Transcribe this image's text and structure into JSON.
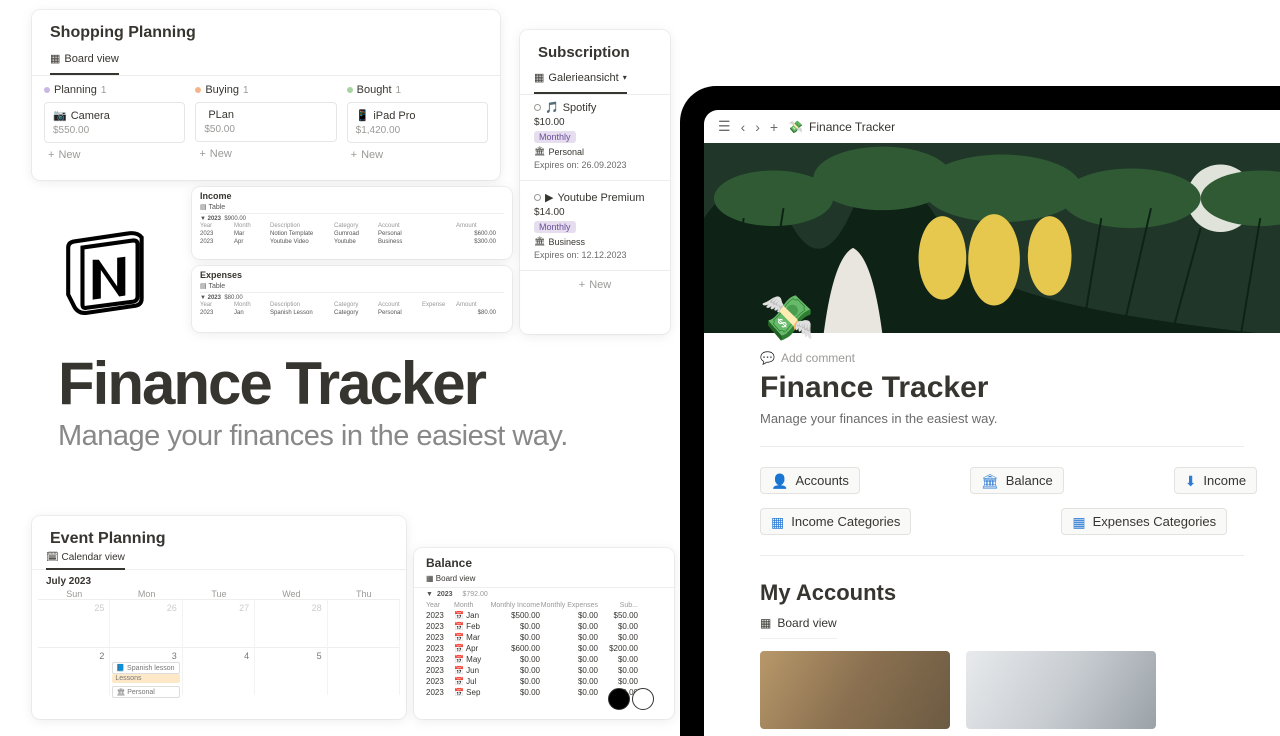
{
  "shopping": {
    "title": "Shopping Planning",
    "view": "Board view",
    "cols": [
      {
        "name": "Planning",
        "count": "1",
        "dot": "#c9b8e4",
        "card_icon": "📷",
        "card_title": "Camera",
        "card_price": "$550.00"
      },
      {
        "name": "Buying",
        "count": "1",
        "dot": "#f5b58b",
        "card_icon": "",
        "card_title": "PLan",
        "card_price": "$50.00"
      },
      {
        "name": "Bought",
        "count": "1",
        "dot": "#a8d4a2",
        "card_icon": "📱",
        "card_title": "iPad Pro",
        "card_price": "$1,420.00"
      }
    ],
    "new_label": "New"
  },
  "subs": {
    "title": "Subscription",
    "view": "Galerieansicht",
    "items": [
      {
        "icon": "🎵",
        "name": "Spotify",
        "price": "$10.00",
        "period": "Monthly",
        "period_bg": "#e6deee",
        "period_fg": "#6a4f9a",
        "acct_icon": "🏛",
        "acct": "Personal",
        "expires": "Expires on: 26.09.2023"
      },
      {
        "icon": "▶",
        "name": "Youtube Premium",
        "price": "$14.00",
        "period": "Monthly",
        "period_bg": "#e6deee",
        "period_fg": "#6a4f9a",
        "acct_icon": "🏛",
        "acct": "Business",
        "expires": "Expires on: 12.12.2023"
      }
    ],
    "new_label": "New"
  },
  "income_thumb": {
    "title": "Income",
    "tab": "Table",
    "year_head": "2023",
    "year_val": "$900.00",
    "rows": [
      {
        "y": "2023",
        "m": "Mar",
        "d": "Notion Template",
        "a": "Gumroad",
        "acc": "Personal",
        "amt": "$600.00"
      },
      {
        "y": "2023",
        "m": "Apr",
        "d": "Youtube Video",
        "a": "Youtube",
        "acc": "Business",
        "amt": "$300.00"
      }
    ],
    "cols": [
      "Year",
      "Month",
      "Description",
      "Category",
      "Account",
      "",
      "Amount"
    ]
  },
  "expenses_thumb": {
    "title": "Expenses",
    "tab": "Table",
    "year_head": "2023",
    "year_val": "$80.00",
    "rows": [
      {
        "y": "2023",
        "m": "Jan",
        "d": "Spanish Lesson",
        "a": "Category",
        "acc": "Personal",
        "amt": "$80.00"
      }
    ],
    "cols": [
      "Year",
      "Month",
      "Description",
      "Category",
      "Account",
      "Expense",
      "Amount"
    ]
  },
  "headline": {
    "title": "Finance Tracker",
    "sub": "Manage your finances in the easiest way."
  },
  "events": {
    "title": "Event Planning",
    "view": "Calendar view",
    "month": "July 2023",
    "days": [
      "Sun",
      "Mon",
      "Tue",
      "Wed",
      "Thu"
    ],
    "row1": [
      "25",
      "26",
      "27",
      "28",
      ""
    ],
    "row2": [
      "2",
      "3",
      "4",
      "5",
      ""
    ],
    "e1": "Spanish lesson",
    "e2": "Lessons",
    "e3": "Personal"
  },
  "balance": {
    "title": "Balance",
    "view": "Board view",
    "year": "2023",
    "total": "$792.00",
    "cols": [
      "Year",
      "Month",
      "Monthly Income",
      "Monthly Expenses",
      "Sub..."
    ],
    "rows": [
      {
        "y": "2023",
        "m": "Jan",
        "inc": "$500.00",
        "exp": "$0.00",
        "s": "$50.00"
      },
      {
        "y": "2023",
        "m": "Feb",
        "inc": "$0.00",
        "exp": "$0.00",
        "s": "$0.00"
      },
      {
        "y": "2023",
        "m": "Mar",
        "inc": "$0.00",
        "exp": "$0.00",
        "s": "$0.00"
      },
      {
        "y": "2023",
        "m": "Apr",
        "inc": "$600.00",
        "exp": "$0.00",
        "s": "$200.00"
      },
      {
        "y": "2023",
        "m": "May",
        "inc": "$0.00",
        "exp": "$0.00",
        "s": "$0.00"
      },
      {
        "y": "2023",
        "m": "Jun",
        "inc": "$0.00",
        "exp": "$0.00",
        "s": "$0.00"
      },
      {
        "y": "2023",
        "m": "Jul",
        "inc": "$0.00",
        "exp": "$0.00",
        "s": "$0.00"
      },
      {
        "y": "2023",
        "m": "Sep",
        "inc": "$0.00",
        "exp": "$0.00",
        "s": "$0.00"
      }
    ]
  },
  "tablet": {
    "breadcrumb": "Finance Tracker",
    "page_icon": "💸",
    "add_comment": "Add comment",
    "title": "Finance Tracker",
    "sub": "Manage your finances in the easiest way.",
    "btn_accounts": "Accounts",
    "btn_balance": "Balance",
    "btn_income": "Income",
    "btn_income_cat": "Income Categories",
    "btn_exp_cat": "Expenses Categories",
    "my_accounts": "My Accounts",
    "board_view": "Board view"
  }
}
